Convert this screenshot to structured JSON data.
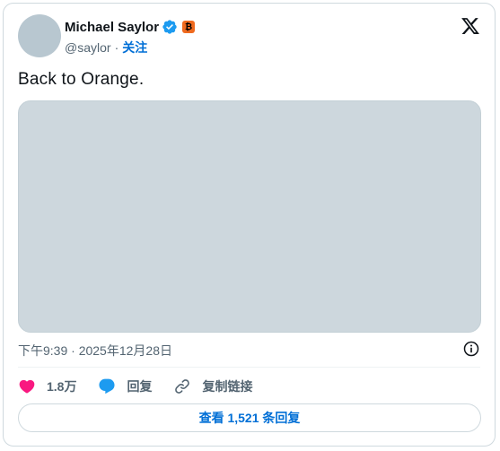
{
  "author": {
    "name": "Michael Saylor",
    "handle": "@saylor",
    "separator": "·",
    "follow_label": "关注",
    "badge_glyph": "₿",
    "verified_icon": "verified-badge-icon",
    "accent_color": "#1d9bf0",
    "badge_color": "#ef6a1f"
  },
  "tweet": {
    "text": "Back to Orange.",
    "timestamp": "下午9:39 · 2025年12月28日"
  },
  "actions": {
    "like_count": "1.8万",
    "reply_label": "回复",
    "copy_link_label": "复制链接"
  },
  "view_replies_label": "查看 1,521 条回复",
  "colors": {
    "link": "#006fd6",
    "like": "#f91880",
    "reply": "#1d9bf0",
    "muted": "#536471",
    "text": "#0f1419"
  }
}
